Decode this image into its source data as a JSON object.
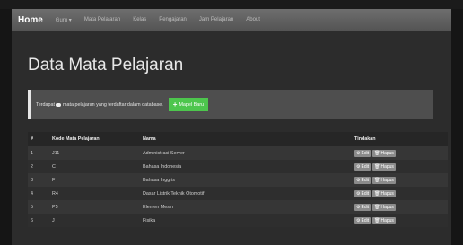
{
  "navbar": {
    "brand": "Home",
    "items": [
      {
        "label": "Guru ▾"
      },
      {
        "label": "Mata Pelajaran"
      },
      {
        "label": "Kelas"
      },
      {
        "label": "Pengajaran"
      },
      {
        "label": "Jam Pelajaran"
      },
      {
        "label": "About"
      }
    ]
  },
  "page": {
    "title": "Data Mata Pelajaran",
    "alert_prefix": "Terdapat",
    "alert_suffix": "mata pelajaran yang terdaftar dalam database.",
    "add_button": "Mapel Baru"
  },
  "table": {
    "headers": [
      "#",
      "Kode Mata Pelajaran",
      "Nama",
      "Tindakan"
    ],
    "edit_label": "Edit",
    "delete_label": "Hapus",
    "rows": [
      {
        "no": "1",
        "kode": "J11",
        "nama": "Administrasi Server"
      },
      {
        "no": "2",
        "kode": "C",
        "nama": "Bahasa Indonesia"
      },
      {
        "no": "3",
        "kode": "F",
        "nama": "Bahasa Inggris"
      },
      {
        "no": "4",
        "kode": "R4",
        "nama": "Dasar Listrik Teknik Otomotif"
      },
      {
        "no": "5",
        "kode": "P5",
        "nama": "Elemen Mesin"
      },
      {
        "no": "6",
        "kode": "J",
        "nama": "Fisika"
      }
    ]
  },
  "colors": {
    "add_button": "#4dc64d",
    "navbar": "#626262",
    "content_bg": "#2c2c2c"
  }
}
